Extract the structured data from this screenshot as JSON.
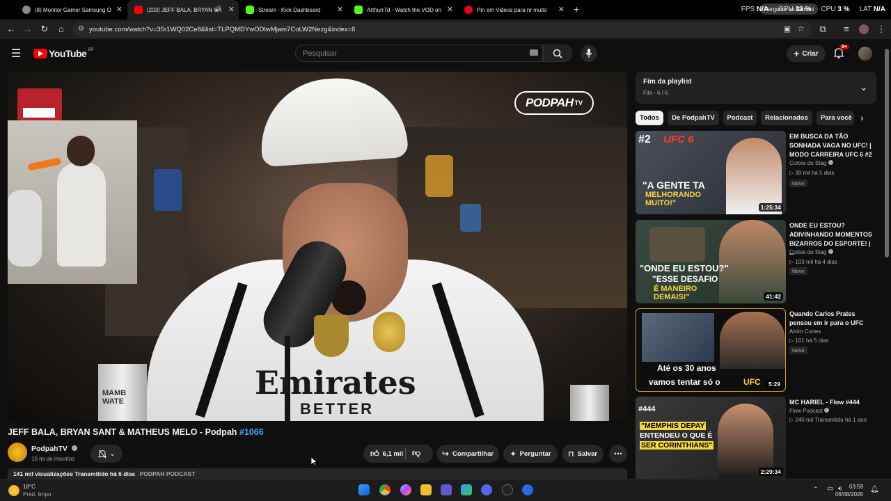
{
  "browser": {
    "tabs": [
      {
        "label": "(8) Monitor Gamer Samsung O",
        "color": "#ffffff"
      },
      {
        "label": "(203) JEFF BALA, BRYAN SA",
        "color": "#ff0000"
      },
      {
        "label": "Stream - Kick Dashboard",
        "color": "#53fc18"
      },
      {
        "label": "Arthurr7d - Watch the VOD on",
        "color": "#53fc18"
      },
      {
        "label": "Pin em Videos para rir muito",
        "color": "#e60023"
      }
    ],
    "new_tab": "+",
    "url": "youtube.com/watch?v=35r1WQ02Ce8&list=TLPQMDYwODIwMjam7CoLW2Nezg&index=6",
    "gemini_tooltip": "Pergunte ao Gemini",
    "hud": {
      "fps_label": "FPS",
      "fps": "N/A",
      "gpu_label": "GPU",
      "gpu": "33 %",
      "cpu_label": "CPU",
      "cpu": "3 %",
      "lat_label": "LAT",
      "lat": "N/A"
    }
  },
  "youtube": {
    "logo": "YouTube",
    "country": "BR",
    "search_placeholder": "Pesquisar",
    "create_label": "Criar",
    "notif_count": "9+"
  },
  "video": {
    "title_main": "JEFF BALA, BRYAN SANT & MATHEUS MELO - Podpah",
    "title_tag": "#1066",
    "watermark": "PODPAH",
    "watermark_tv": "TV",
    "jersey_text": "Emirates",
    "jersey_sub": "BETTER",
    "can_text": "MAMB WATE",
    "channel": "PodpahTV",
    "subs": "10 mi de inscritos",
    "likes": "6,1 mil",
    "share_label": "Compartilhar",
    "ask_label": "Perguntar",
    "save_label": "Salvar",
    "views_line": "141 mil visualizações  Transmitido há 6 dias",
    "views_tag": "PODPAH PODCAST"
  },
  "playlist": {
    "title": "Fim da playlist",
    "sub": "Fila - 6 / 6"
  },
  "chips": [
    "Todos",
    "De PodpahTV",
    "Podcast",
    "Relacionados",
    "Para você"
  ],
  "recommendations": [
    {
      "title": "EM BUSCA DA TÃO SONHADA VAGA NO UFC! | MODO CARREIRA UFC 6 #2",
      "channel": "Cortes do Stag",
      "meta": "39 mil  há 5 dias",
      "badge": "Novo",
      "duration": "1:25:34",
      "overlay_a": "#2",
      "overlay_b": "UFC 6",
      "overlay_c": "\"A GENTE TA",
      "overlay_d": "MELHORANDO MUITO!\"",
      "bg": "#3b3f4a"
    },
    {
      "title": "ONDE EU ESTOU? ADIVINHANDO MOMENTOS BIZARROS DO ESPORTE! | ...",
      "channel": "Cortes do Stag",
      "meta": "103 mil  há 4 dias",
      "badge": "Novo",
      "duration": "41:42",
      "overlay_a": "\"ONDE EU ESTOU?\"",
      "overlay_b": "\"ESSE DESAFIO",
      "overlay_c": "É MANEIRO DEMAIS!\"",
      "bg": "#33413a"
    },
    {
      "title": "Quando Carlos Prates pensou em ir para o UFC",
      "channel": "Alvim Cortes",
      "meta": "101  há 5 dias",
      "badge": "Novo",
      "duration": "5:29",
      "overlay_a": "Até os 30 anos",
      "overlay_b": "vamos tentar só o",
      "overlay_c": "UFC",
      "bg": "#2a2a2a"
    },
    {
      "title": "MC HARIEL - Flow #444",
      "channel": "Flow Podcast",
      "meta": "240 mil  Transmitido há 1 ano",
      "badge": "",
      "duration": "2:29:34",
      "overlay_a": "#444",
      "overlay_b": "\"MEMPHIS DEPAY",
      "overlay_c": "ENTENDEU O QUE É",
      "overlay_d": "SER CORINTHIANS\"",
      "bg": "#3a3a3a"
    }
  ],
  "taskbar": {
    "temp": "18°C",
    "weather": "Pred. limpo",
    "time": "03:59",
    "date": "06/08/2026"
  },
  "colors": {
    "accent": "#3ea6ff",
    "yt_red": "#ff0000",
    "bg": "#0f0f0f"
  }
}
